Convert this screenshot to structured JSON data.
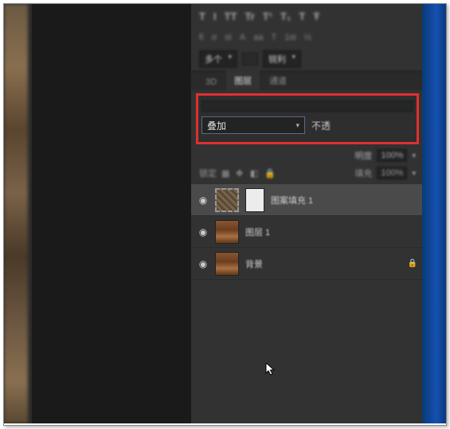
{
  "options": {
    "multi": "多个",
    "sharp": "锐利"
  },
  "panel": {
    "tabs": [
      "3D",
      "图层",
      "通道"
    ],
    "blendMode": "叠加",
    "opacityLabel": "不透",
    "opacityExtraLabel": "明度",
    "opacityValue": "100%",
    "lockLabel": "锁定",
    "fillLabel": "填充",
    "fillValue": "100%"
  },
  "layers": [
    {
      "name": "图案填充 1",
      "selected": true,
      "hasMask": true,
      "thumbType": "pattern",
      "locked": false
    },
    {
      "name": "图层 1",
      "selected": false,
      "hasMask": false,
      "thumbType": "img",
      "locked": false
    },
    {
      "name": "背景",
      "selected": false,
      "hasMask": false,
      "thumbType": "img",
      "locked": true
    }
  ]
}
